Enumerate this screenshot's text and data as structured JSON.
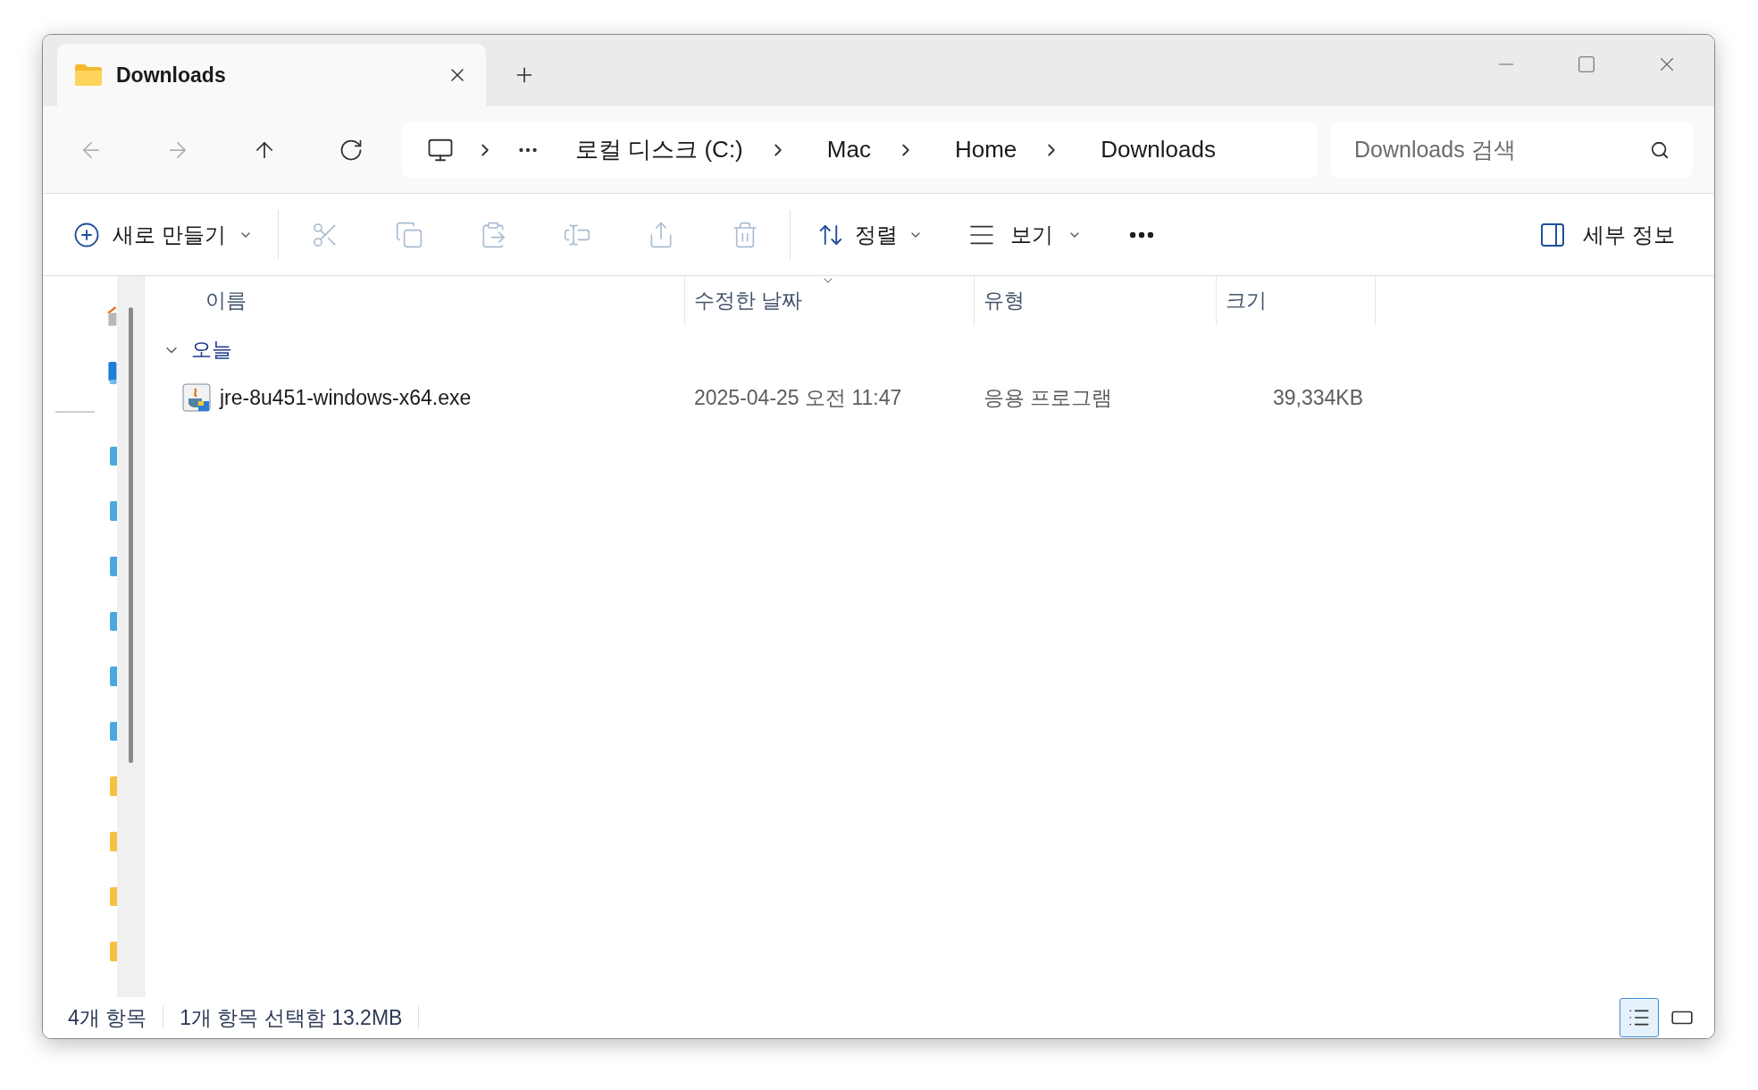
{
  "window": {
    "tab_title": "Downloads"
  },
  "nav": [
    {
      "kind": "back",
      "disabled": true
    },
    {
      "kind": "forward",
      "disabled": true
    },
    {
      "kind": "up",
      "disabled": false
    },
    {
      "kind": "refresh",
      "disabled": false
    }
  ],
  "breadcrumb": [
    "로컬 디스크 (C:)",
    "Mac",
    "Home",
    "Downloads"
  ],
  "search": {
    "placeholder": "Downloads 검색"
  },
  "toolbar": {
    "new_label": "새로 만들기",
    "actions": [
      {
        "kind": "cut",
        "disabled": true
      },
      {
        "kind": "copy",
        "disabled": true
      },
      {
        "kind": "paste",
        "disabled": true
      },
      {
        "kind": "rename",
        "disabled": true
      },
      {
        "kind": "share",
        "disabled": true
      },
      {
        "kind": "delete",
        "disabled": true
      }
    ],
    "sort_label": "정렬",
    "view_label": "보기",
    "details_label": "세부 정보"
  },
  "sidebar": [
    {
      "kind": "home"
    },
    {
      "kind": "gallery"
    },
    {
      "kind": "separator"
    },
    {
      "kind": "folder",
      "color": "#4aa8e0"
    },
    {
      "kind": "folder",
      "color": "#4aa8e0"
    },
    {
      "kind": "folder",
      "color": "#4aa8e0"
    },
    {
      "kind": "folder",
      "color": "#4aa8e0"
    },
    {
      "kind": "folder",
      "color": "#4aa8e0"
    },
    {
      "kind": "folder",
      "color": "#4aa8e0"
    },
    {
      "kind": "folder",
      "color": "#f5c242"
    },
    {
      "kind": "folder",
      "color": "#f5c242"
    },
    {
      "kind": "folder",
      "color": "#f5c242"
    },
    {
      "kind": "folder",
      "color": "#f5c242"
    }
  ],
  "columns": [
    {
      "label": "이름",
      "sorted": false
    },
    {
      "label": "수정한 날짜",
      "sorted": true
    },
    {
      "label": "유형",
      "sorted": false
    },
    {
      "label": "크기",
      "sorted": false
    }
  ],
  "groups": [
    {
      "label": "오늘",
      "expanded": true,
      "items": [
        {
          "name": "jre-8u451-windows-x64.exe",
          "date": "2025-04-25 오전 11:47",
          "type": "응용 프로그램",
          "size": "39,334KB",
          "selected": false
        }
      ]
    }
  ],
  "status_bar": {
    "count": "4개 항목",
    "selection": "1개 항목 선택함 13.2MB"
  },
  "view_buttons": [
    {
      "kind": "details",
      "selected": true
    },
    {
      "kind": "tiles",
      "selected": false
    }
  ]
}
